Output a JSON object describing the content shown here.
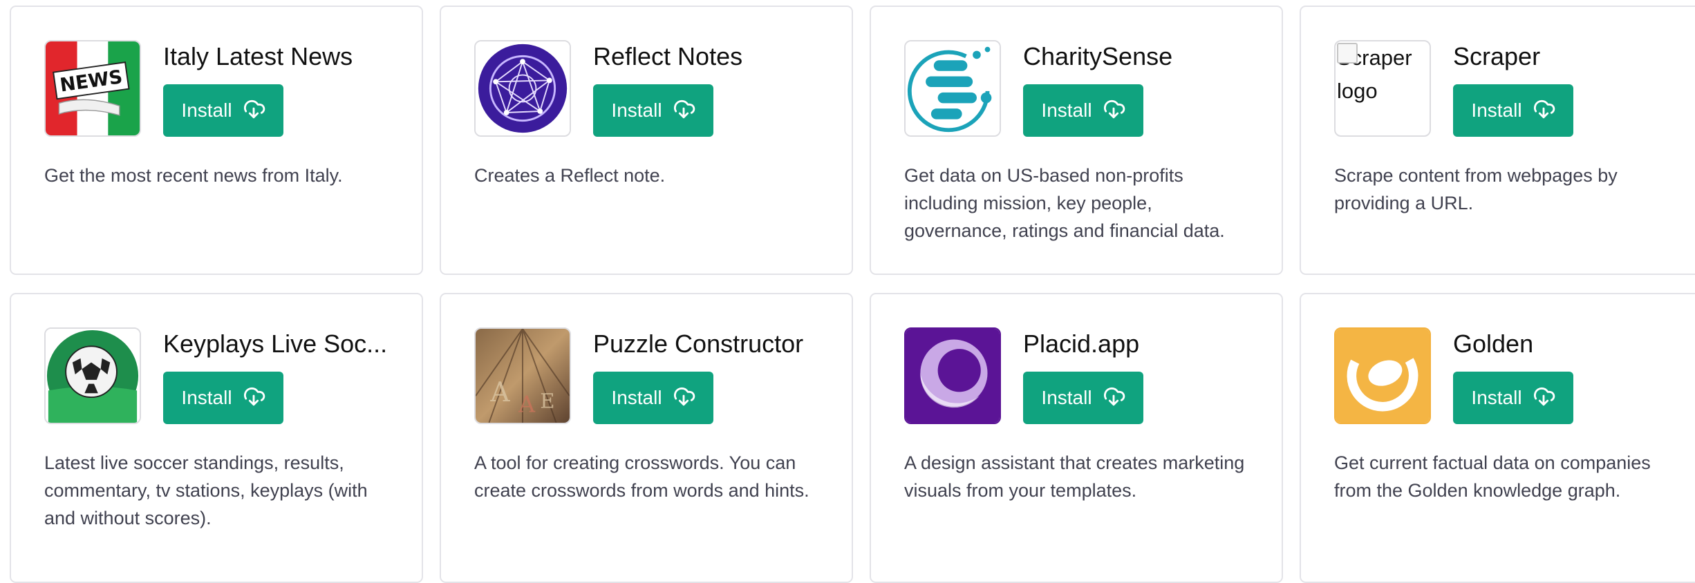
{
  "install_label": "Install",
  "plugins": [
    {
      "title": "Italy Latest News",
      "description": "Get the most recent news from Italy.",
      "icon": "italy-news-logo-icon"
    },
    {
      "title": "Reflect Notes",
      "description": "Creates a Reflect note.",
      "icon": "reflect-notes-logo-icon"
    },
    {
      "title": "CharitySense",
      "description": "Get data on US-based non-profits including mission, key people, governance, ratings and financial data.",
      "icon": "charitysense-logo-icon"
    },
    {
      "title": "Scraper",
      "description": "Scrape content from webpages by providing a URL.",
      "icon": "scraper-logo-icon",
      "logo_alt": "Scraper logo"
    },
    {
      "title": "Keyplays Live Soc...",
      "description": "Latest live soccer standings, results, commentary, tv stations, keyplays (with and without scores).",
      "icon": "soccer-ball-logo-icon"
    },
    {
      "title": "Puzzle Constructor",
      "description": "A tool for creating crosswords. You can create crosswords from words and hints.",
      "icon": "puzzle-constructor-logo-icon"
    },
    {
      "title": "Placid.app",
      "description": "A design assistant that creates marketing visuals from your templates.",
      "icon": "placid-logo-icon"
    },
    {
      "title": "Golden",
      "description": "Get current factual data on companies from the Golden knowledge graph.",
      "icon": "golden-logo-icon"
    }
  ],
  "colors": {
    "install_bg": "#10a37f",
    "border": "#e3e3e8"
  }
}
